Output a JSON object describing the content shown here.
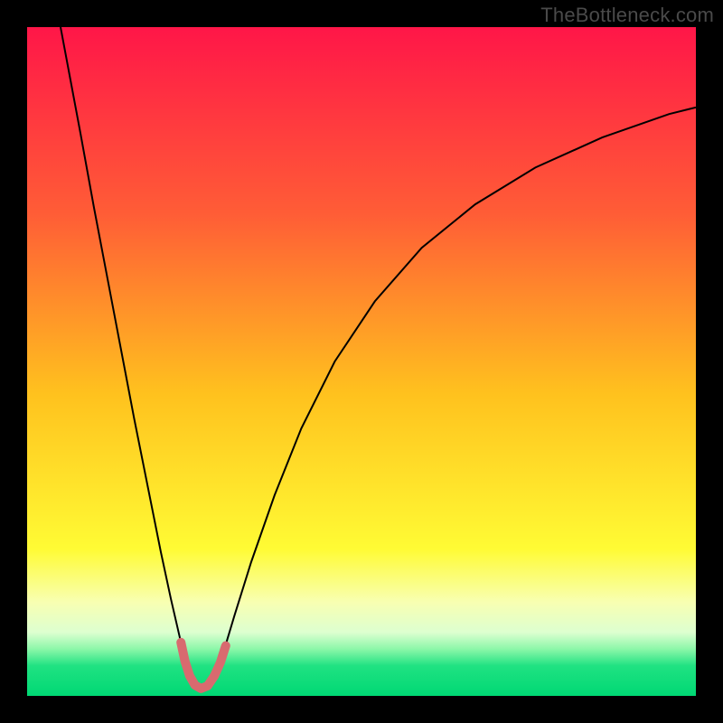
{
  "watermark": "TheBottleneck.com",
  "chart_data": {
    "type": "line",
    "title": "",
    "xlabel": "",
    "ylabel": "",
    "xlim": [
      0,
      100
    ],
    "ylim": [
      0,
      100
    ],
    "grid": false,
    "background_gradient": {
      "stops": [
        {
          "offset": 0.0,
          "color": "#ff1648"
        },
        {
          "offset": 0.28,
          "color": "#ff5d36"
        },
        {
          "offset": 0.55,
          "color": "#ffc21e"
        },
        {
          "offset": 0.78,
          "color": "#fffb34"
        },
        {
          "offset": 0.86,
          "color": "#f8ffb2"
        },
        {
          "offset": 0.905,
          "color": "#ddffd0"
        },
        {
          "offset": 0.93,
          "color": "#8cf7a9"
        },
        {
          "offset": 0.955,
          "color": "#20e282"
        },
        {
          "offset": 1.0,
          "color": "#00d874"
        }
      ]
    },
    "series": [
      {
        "name": "left-branch",
        "stroke": "#000000",
        "stroke_width": 2.0,
        "points": [
          {
            "x": 5.0,
            "y": 100.0
          },
          {
            "x": 6.5,
            "y": 92.0
          },
          {
            "x": 8.0,
            "y": 84.0
          },
          {
            "x": 10.0,
            "y": 73.0
          },
          {
            "x": 12.0,
            "y": 62.5
          },
          {
            "x": 14.0,
            "y": 52.0
          },
          {
            "x": 16.0,
            "y": 41.5
          },
          {
            "x": 18.0,
            "y": 31.5
          },
          {
            "x": 20.0,
            "y": 21.5
          },
          {
            "x": 21.5,
            "y": 14.5
          },
          {
            "x": 23.0,
            "y": 8.0
          },
          {
            "x": 24.0,
            "y": 4.5
          },
          {
            "x": 25.0,
            "y": 2.0
          },
          {
            "x": 26.0,
            "y": 0.8
          }
        ]
      },
      {
        "name": "right-branch",
        "stroke": "#000000",
        "stroke_width": 2.0,
        "points": [
          {
            "x": 26.0,
            "y": 0.8
          },
          {
            "x": 27.0,
            "y": 1.3
          },
          {
            "x": 28.0,
            "y": 3.0
          },
          {
            "x": 29.5,
            "y": 7.0
          },
          {
            "x": 31.0,
            "y": 12.0
          },
          {
            "x": 33.5,
            "y": 20.0
          },
          {
            "x": 37.0,
            "y": 30.0
          },
          {
            "x": 41.0,
            "y": 40.0
          },
          {
            "x": 46.0,
            "y": 50.0
          },
          {
            "x": 52.0,
            "y": 59.0
          },
          {
            "x": 59.0,
            "y": 67.0
          },
          {
            "x": 67.0,
            "y": 73.5
          },
          {
            "x": 76.0,
            "y": 79.0
          },
          {
            "x": 86.0,
            "y": 83.5
          },
          {
            "x": 96.0,
            "y": 87.0
          },
          {
            "x": 100.0,
            "y": 88.0
          }
        ]
      },
      {
        "name": "bottom-marker",
        "stroke": "#d86a6f",
        "stroke_width": 10,
        "linecap": "round",
        "points": [
          {
            "x": 23.0,
            "y": 8.0
          },
          {
            "x": 23.6,
            "y": 5.2
          },
          {
            "x": 24.3,
            "y": 3.0
          },
          {
            "x": 25.1,
            "y": 1.6
          },
          {
            "x": 26.0,
            "y": 1.1
          },
          {
            "x": 27.0,
            "y": 1.5
          },
          {
            "x": 28.0,
            "y": 3.0
          },
          {
            "x": 28.9,
            "y": 5.0
          },
          {
            "x": 29.7,
            "y": 7.5
          }
        ]
      }
    ]
  }
}
